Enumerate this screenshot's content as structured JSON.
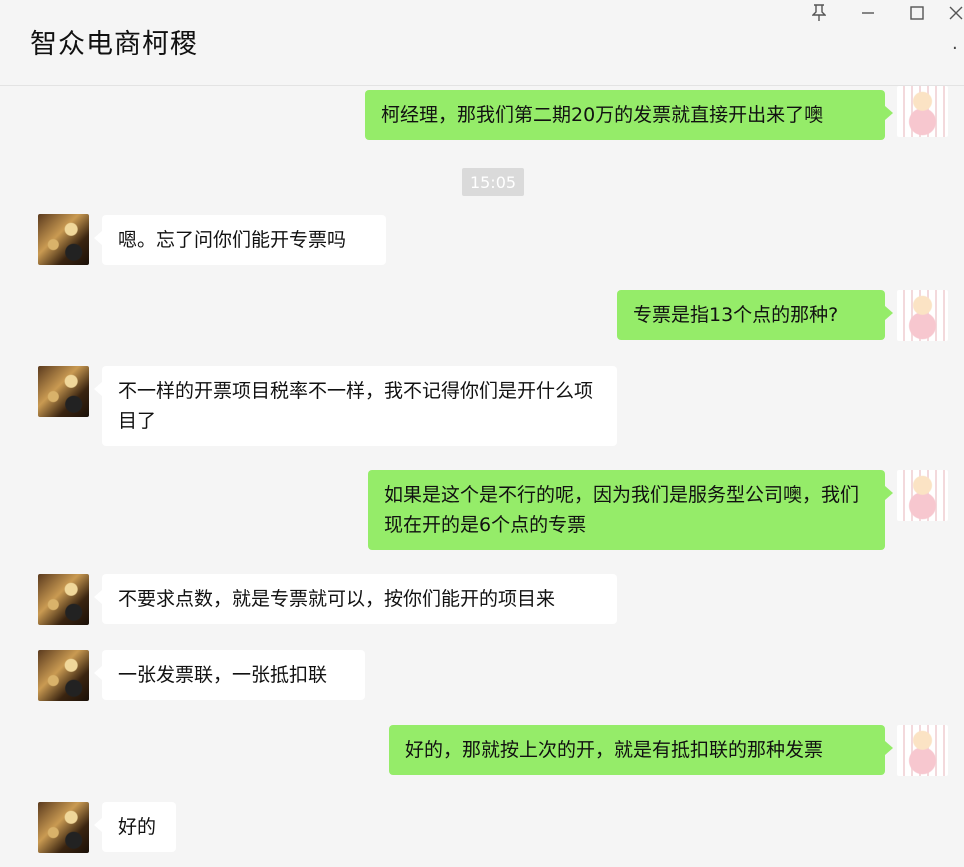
{
  "window": {
    "title": "智众电商柯稷",
    "controls": {
      "pin_icon": "pin-icon",
      "minimize_icon": "minimize-icon",
      "maximize_icon": "maximize-icon",
      "close_icon": "close-icon",
      "more_icon": "more-icon"
    }
  },
  "colors": {
    "outgoing_bubble": "#95ec69",
    "incoming_bubble": "#ffffff",
    "background": "#f5f5f5"
  },
  "chat": {
    "timestamp": "15:05",
    "messages": [
      {
        "sender": "me",
        "text": "柯经理，那我们第二期20万的发票就直接开出来了噢"
      },
      {
        "sender": "other",
        "text": "嗯。忘了问你们能开专票吗"
      },
      {
        "sender": "me",
        "text": "专票是指13个点的那种?"
      },
      {
        "sender": "other",
        "text": "不一样的开票项目税率不一样，我不记得你们是开什么项目了"
      },
      {
        "sender": "me",
        "text": "如果是这个是不行的呢，因为我们是服务型公司噢，我们现在开的是6个点的专票"
      },
      {
        "sender": "other",
        "text": "不要求点数，就是专票就可以，按你们能开的项目来"
      },
      {
        "sender": "other",
        "text": "一张发票联，一张抵扣联"
      },
      {
        "sender": "me",
        "text": "好的，那就按上次的开，就是有抵扣联的那种发票"
      },
      {
        "sender": "other",
        "text": "好的"
      }
    ]
  }
}
